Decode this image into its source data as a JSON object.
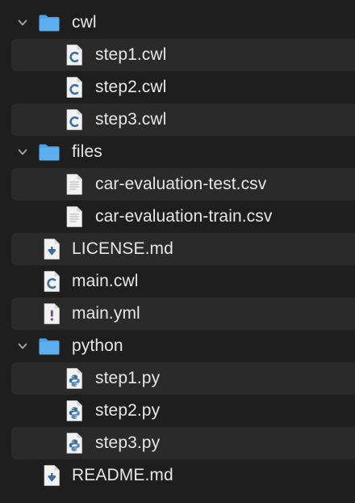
{
  "tree": [
    {
      "id": "cwl",
      "type": "folder",
      "label": "cwl",
      "expanded": true
    },
    {
      "id": "step1-cwl",
      "type": "file",
      "icon": "cwl-icon",
      "label": "step1.cwl"
    },
    {
      "id": "step2-cwl",
      "type": "file",
      "icon": "cwl-icon",
      "label": "step2.cwl"
    },
    {
      "id": "step3-cwl",
      "type": "file",
      "icon": "cwl-icon",
      "label": "step3.cwl"
    },
    {
      "id": "files",
      "type": "folder",
      "label": "files",
      "expanded": true
    },
    {
      "id": "test-csv",
      "type": "file",
      "icon": "text-file-icon",
      "label": "car-evaluation-test.csv"
    },
    {
      "id": "train-csv",
      "type": "file",
      "icon": "text-file-icon",
      "label": "car-evaluation-train.csv"
    },
    {
      "id": "license",
      "type": "file",
      "icon": "markdown-icon",
      "label": "LICENSE.md"
    },
    {
      "id": "main-cwl",
      "type": "file",
      "icon": "cwl-icon",
      "label": "main.cwl"
    },
    {
      "id": "main-yml",
      "type": "file",
      "icon": "yaml-icon",
      "label": "main.yml"
    },
    {
      "id": "python",
      "type": "folder",
      "label": "python",
      "expanded": true
    },
    {
      "id": "step1-py",
      "type": "file",
      "icon": "python-icon",
      "label": "step1.py"
    },
    {
      "id": "step2-py",
      "type": "file",
      "icon": "python-icon",
      "label": "step2.py"
    },
    {
      "id": "step3-py",
      "type": "file",
      "icon": "python-icon",
      "label": "step3.py"
    },
    {
      "id": "readme",
      "type": "file",
      "icon": "markdown-icon",
      "label": "README.md"
    }
  ],
  "colors": {
    "background": "#1e1e1e",
    "stripe": "#2a2a2a",
    "folder": "#5cb0f0",
    "text": "#e6e6e6",
    "chevron": "#a8a8a8",
    "cwl_letter": "#3f6fa0",
    "markdown_arrow": "#3d6c9b",
    "yaml_mark": "#7a3fa0",
    "python_mark": "#3f6c99"
  }
}
